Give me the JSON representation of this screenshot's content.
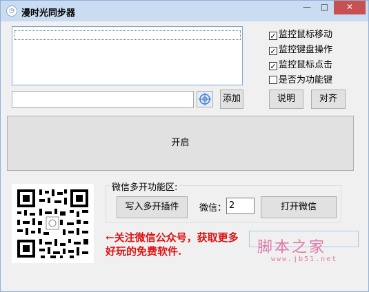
{
  "window": {
    "title": "漫时光同步器",
    "min_label": "—",
    "max_label": "□",
    "close_label": "✕"
  },
  "main": {
    "add_label": "添加",
    "checkboxes": [
      {
        "label": "监控鼠标移动",
        "checked": true
      },
      {
        "label": "监控键盘操作",
        "checked": true
      },
      {
        "label": "监控鼠标点击",
        "checked": true
      },
      {
        "label": "是否为功能键",
        "checked": false
      }
    ],
    "help_label": "说明",
    "align_label": "对齐",
    "start_label": "开启"
  },
  "wechat": {
    "group_title": "微信多开功能区:",
    "write_plugin_label": "写入多开插件",
    "count_label": "微信：",
    "count_value": "2",
    "open_label": "打开微信"
  },
  "promo": {
    "text": "←关注微信公众号，获取更多好玩的免费软件."
  },
  "watermark": {
    "cn": "脚本之家",
    "url": "www.jb51.net"
  },
  "colors": {
    "titlebar": "#c9dcf2",
    "close": "#c75050",
    "promo": "#e01010",
    "watermark": "#e07aa8"
  }
}
